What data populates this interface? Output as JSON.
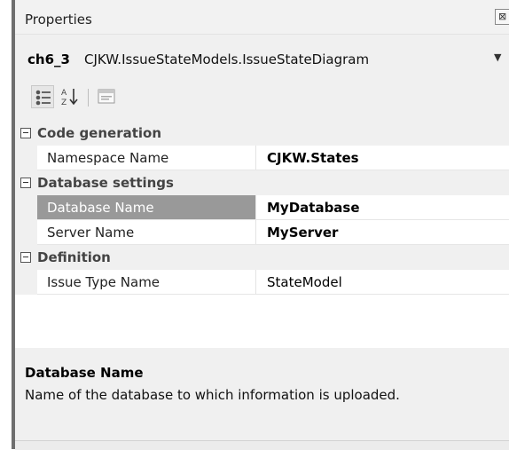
{
  "panel": {
    "title": "Properties",
    "close_glyph": "⊠"
  },
  "object_selector": {
    "name": "ch6_3",
    "type": "CJKW.IssueStateModels.IssueStateDiagram",
    "dropdown_glyph": "▼"
  },
  "toolbar": {
    "buttons": [
      {
        "icon": "categorized-icon",
        "pressed": true
      },
      {
        "icon": "alphabetical-sort-icon",
        "pressed": false
      },
      {
        "icon": "property-pages-icon",
        "pressed": false
      }
    ]
  },
  "grid": {
    "categories": [
      {
        "label": "Code generation",
        "properties": [
          {
            "name": "Namespace Name",
            "value": "CJKW.States",
            "bold": true,
            "selected": false
          }
        ]
      },
      {
        "label": "Database settings",
        "properties": [
          {
            "name": "Database Name",
            "value": "MyDatabase",
            "bold": true,
            "selected": true
          },
          {
            "name": "Server Name",
            "value": "MyServer",
            "bold": true,
            "selected": false
          }
        ]
      },
      {
        "label": "Definition",
        "properties": [
          {
            "name": "Issue Type Name",
            "value": "StateModel",
            "bold": false,
            "selected": false
          }
        ]
      }
    ]
  },
  "description": {
    "title": "Database Name",
    "text": "Name of the database to which information is uploaded."
  },
  "colors": {
    "selection": "#999999",
    "category_background": "#f0f0f0",
    "grid_background": "#ffffff"
  }
}
